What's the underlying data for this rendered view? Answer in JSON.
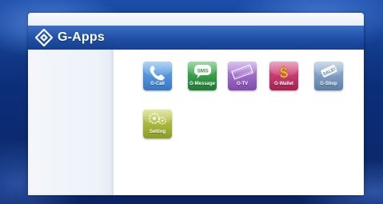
{
  "header": {
    "title": "G-Apps"
  },
  "apps": [
    {
      "label": "G-Call",
      "icon": "phone-icon",
      "color": "#4a8fd6"
    },
    {
      "label": "G-Message",
      "icon": "sms-bubble-icon",
      "icon_text": "SMS",
      "color": "#2f9a44"
    },
    {
      "label": "G-TV",
      "icon": "film-icon",
      "color": "#9b67c6"
    },
    {
      "label": "G-Wallet",
      "icon": "dollar-icon",
      "icon_text": "$",
      "color": "#c7356a"
    },
    {
      "label": "G-Shop",
      "icon": "sale-tag-icon",
      "icon_text": "SALE!",
      "color": "#6f8fb8"
    },
    {
      "label": "Setting",
      "icon": "gears-icon",
      "color": "#a8b83a"
    }
  ]
}
